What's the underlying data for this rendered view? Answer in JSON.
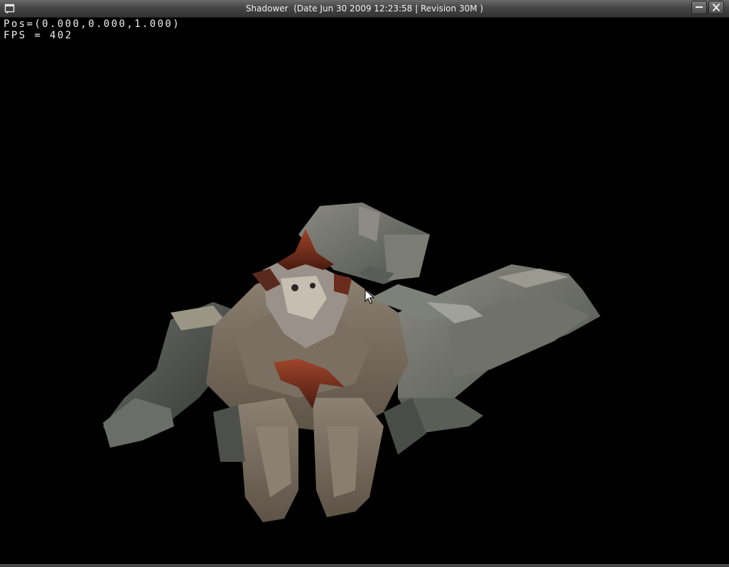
{
  "window": {
    "title": "Shadower  (Date Jun 30 2009 12:23:58 | Revision 30M )"
  },
  "hud": {
    "position_line": "Pos=(0.000,0.000,1.000)",
    "fps_line": "FPS = 402"
  },
  "icons": {
    "app": "window-app-icon",
    "minimize": "minimize-icon",
    "close": "close-icon",
    "cursor": "mouse-pointer-icon"
  },
  "colors": {
    "background": "#000000",
    "hud_text": "#f0f0f0",
    "titlebar": "#454545"
  }
}
